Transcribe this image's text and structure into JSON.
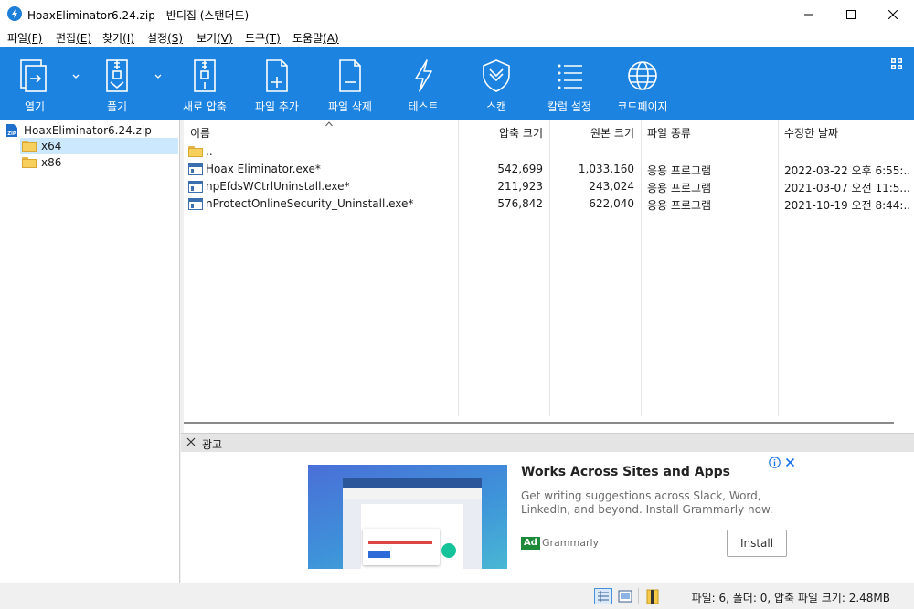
{
  "window": {
    "title": "HoaxEliminator6.24.zip - 반디집 (스탠더드)"
  },
  "menu": [
    {
      "label": "파일",
      "key": "(F)"
    },
    {
      "label": "편집",
      "key": "(E)"
    },
    {
      "label": "찾기",
      "key": "(I)"
    },
    {
      "label": "설정",
      "key": "(S)"
    },
    {
      "label": "보기",
      "key": "(V)"
    },
    {
      "label": "도구",
      "key": "(T)"
    },
    {
      "label": "도움말",
      "key": "(A)"
    }
  ],
  "toolbar": {
    "open": "열기",
    "extract": "풀기",
    "new_archive": "새로 압축",
    "add_file": "파일 추가",
    "delete_file": "파일 삭제",
    "test": "테스트",
    "scan": "스캔",
    "column_settings": "칼럼 설정",
    "codepage": "코드페이지"
  },
  "tree": {
    "root": "HoaxEliminator6.24.zip",
    "nodes": [
      "x64",
      "x86"
    ]
  },
  "columns": {
    "name": "이름",
    "packed_size": "압축 크기",
    "original_size": "원본 크기",
    "file_type": "파일 종류",
    "modified": "수정한 날짜"
  },
  "parent_row": "..",
  "files": [
    {
      "name": "Hoax Eliminator.exe*",
      "packed_size": "542,699",
      "original_size": "1,033,160",
      "type": "응용 프로그램",
      "modified": "2022-03-22 오후 6:55:..."
    },
    {
      "name": "npEfdsWCtrlUninstall.exe*",
      "packed_size": "211,923",
      "original_size": "243,024",
      "type": "응용 프로그램",
      "modified": "2021-03-07 오전 11:5..."
    },
    {
      "name": "nProtectOnlineSecurity_Uninstall.exe*",
      "packed_size": "576,842",
      "original_size": "622,040",
      "type": "응용 프로그램",
      "modified": "2021-10-19 오전 8:44:..."
    }
  ],
  "ad": {
    "bar_label": "광고",
    "title": "Works Across Sites and Apps",
    "description": "Get writing suggestions across Slack, Word, LinkedIn, and beyond. Install Grammarly now.",
    "tag": "Ad",
    "brand": "Grammarly",
    "button": "Install"
  },
  "status": {
    "text": "파일: 6, 폴더: 0, 압축 파일 크기: 2.48MB"
  },
  "colors": {
    "toolbar": "#1c83e0",
    "selection": "#cce8ff",
    "ad_tag": "#1d8a3a"
  }
}
